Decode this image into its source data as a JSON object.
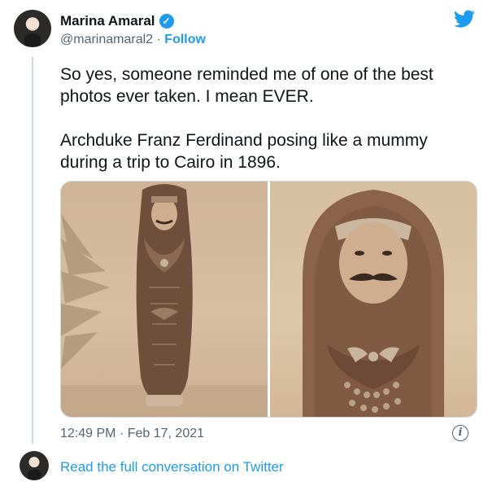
{
  "author": {
    "name": "Marina Amaral",
    "handle": "@marinamaral2",
    "separator": "·",
    "follow_label": "Follow"
  },
  "tweet": {
    "paragraphs": [
      "So yes, someone reminded me of one of the best photos ever taken. I mean EVER.",
      "Archduke Franz Ferdinand posing like a mummy during a trip to Cairo in 1896."
    ],
    "time": "12:49 PM",
    "date": "Feb 17, 2021",
    "time_separator": "·"
  },
  "footer": {
    "read_link": "Read the full conversation on Twitter"
  },
  "icons": {
    "verified": "verified-badge-icon",
    "twitter": "twitter-bird-icon",
    "info": "info-icon"
  },
  "colors": {
    "accent": "#1d9bf0",
    "text": "#0f1419",
    "muted": "#536471",
    "border": "#cfd9de"
  }
}
